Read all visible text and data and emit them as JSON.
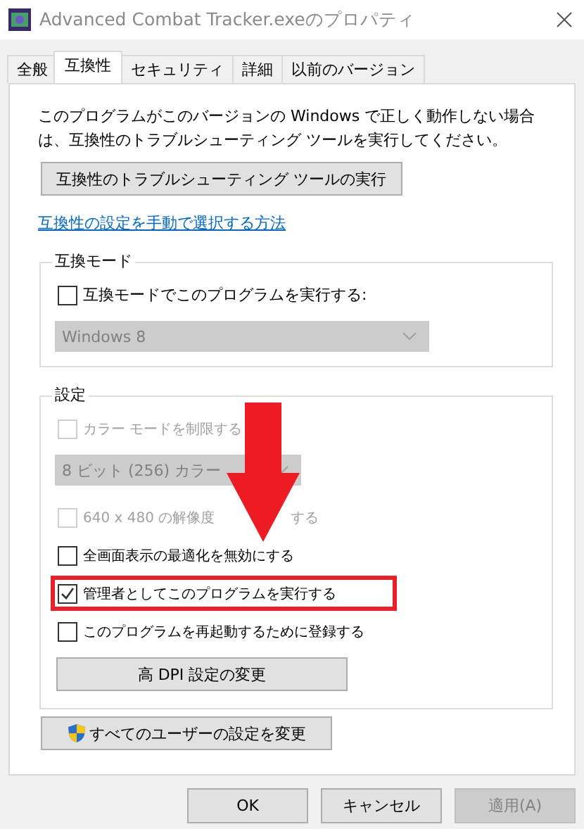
{
  "window": {
    "title": "Advanced Combat Tracker.exeのプロパティ"
  },
  "tabs": [
    {
      "label": "全般",
      "selected": false
    },
    {
      "label": "互換性",
      "selected": true
    },
    {
      "label": "セキュリティ",
      "selected": false
    },
    {
      "label": "詳細",
      "selected": false
    },
    {
      "label": "以前のバージョン",
      "selected": false
    }
  ],
  "description": "このプログラムがこのバージョンの Windows で正しく動作しない場合は、互換性のトラブルシューティング ツールを実行してください。",
  "troubleshoot_button": "互換性のトラブルシューティング ツールの実行",
  "help_link": "互換性の設定を手動で選択する方法",
  "compat_mode": {
    "title": "互換モード",
    "checkbox": {
      "label": "互換モードでこのプログラムを実行する:",
      "checked": false
    },
    "select": {
      "value": "Windows 8",
      "disabled": true
    }
  },
  "settings": {
    "title": "設定",
    "items": [
      {
        "kind": "checkbox",
        "label": "カラー モードを制限する",
        "checked": false,
        "disabled": true,
        "highlighted": false
      },
      {
        "kind": "select",
        "value": "8 ビット (256) カラー",
        "disabled": true
      },
      {
        "kind": "checkbox",
        "label": "640 x 480 の解像度",
        "label_tail": "する",
        "checked": false,
        "disabled": true,
        "highlighted": false
      },
      {
        "kind": "checkbox",
        "label": "全画面表示の最適化を無効にする",
        "checked": false,
        "disabled": false,
        "highlighted": false
      },
      {
        "kind": "checkbox",
        "label": "管理者としてこのプログラムを実行する",
        "checked": true,
        "disabled": false,
        "highlighted": true
      },
      {
        "kind": "checkbox",
        "label": "このプログラムを再起動するために登録する",
        "checked": false,
        "disabled": false,
        "highlighted": false
      },
      {
        "kind": "button",
        "label": "高 DPI 設定の変更"
      }
    ]
  },
  "all_users_button": "すべてのユーザーの設定を変更",
  "buttons": [
    {
      "label": "OK",
      "disabled": false
    },
    {
      "label": "キャンセル",
      "disabled": false
    },
    {
      "label": "適用(A)",
      "disabled": true
    }
  ]
}
